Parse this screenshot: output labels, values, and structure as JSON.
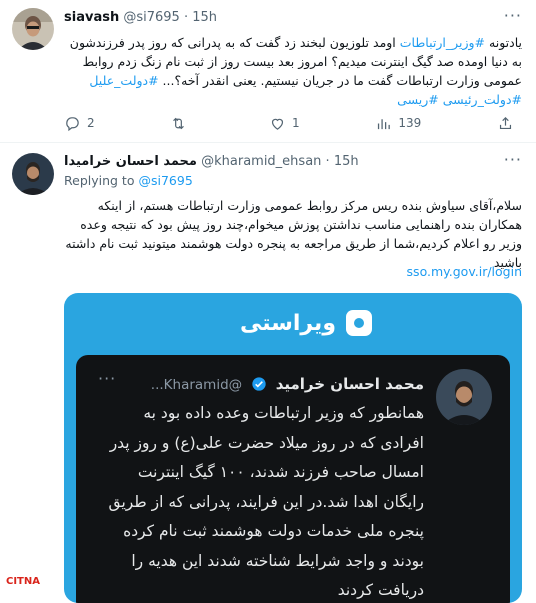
{
  "tweet1": {
    "name": "siavash",
    "handle": "@si7695",
    "separator": "·",
    "time": "15h",
    "text_parts": [
      {
        "t": "یادتونه ",
        "tag": false
      },
      {
        "t": "#وزیر_ارتباطات",
        "tag": true
      },
      {
        "t": " اومد تلوزیون لبخند زد گفت که به پدرانی که روز پدر فرزندشون به دنیا اومده صد گیگ اینترنت میدیم؟ امروز بعد بیست روز از ثبت نام زنگ زدم روابط عمومی وزارت ارتباطات گفت ما در جریان نیستیم.  یعنی انقدر آخه؟... ",
        "tag": false
      },
      {
        "t": "#دولت_علیل",
        "tag": true
      },
      {
        "t": " ",
        "tag": false
      },
      {
        "t": "#دولت_رئیسی",
        "tag": true
      },
      {
        "t": " ",
        "tag": false
      },
      {
        "t": "#ریسی",
        "tag": true
      }
    ],
    "replies": "2",
    "retweets": "",
    "likes": "1",
    "views": "139"
  },
  "tweet2": {
    "name": "محمد احسان خرامیدا",
    "handle": "@kharamid_ehsan",
    "separator": "·",
    "time": "15h",
    "replying_label": "Replying to",
    "replying_to": "@si7695",
    "text": "سلام،آقای سیاوش بنده ریس مرکز روابط عمومی وزارت ارتباطات هستم، از اینکه همکاران بنده راهنمایی مناسب نداشتن پوزش میخوام،چند روز پیش بود که نتیجه وعده وزیر رو اعلام کردیم،شما از طریق مراجعه به پنجره دولت هوشمند میتونید ثبت نام داشته باشید",
    "link": "sso.my.gov.ir/login"
  },
  "embed": {
    "logo_text": "ویراستی",
    "card_name": "محمد احسان خرامید",
    "card_handle": "@Kharamid...",
    "card_text": "همانطور که وزیر ارتباطات وعده داده بود به افرادی که در روز میلاد حضرت علی(ع) و روز پدر امسال صاحب فرزند شدند، ۱۰۰ گیگ اینترنت رایگان اهدا شد.در این فرایند، پدرانی که از طریق پنجره ملی خدمات دولت هوشمند ثبت نام کرده بودند و واجد شرایط شناخته شدند این هدیه را دریافت کردند"
  },
  "watermark": "CITNA",
  "icons": {
    "reply": "reply-icon",
    "retweet": "retweet-icon",
    "like": "like-icon",
    "views": "views-icon",
    "share": "share-icon",
    "more": "more-icon",
    "verified": "verified-badge-icon"
  },
  "colors": {
    "accent": "#1d9bf0",
    "muted": "#536471",
    "embed_bg": "#2aa5e0",
    "card_bg": "#111315"
  }
}
